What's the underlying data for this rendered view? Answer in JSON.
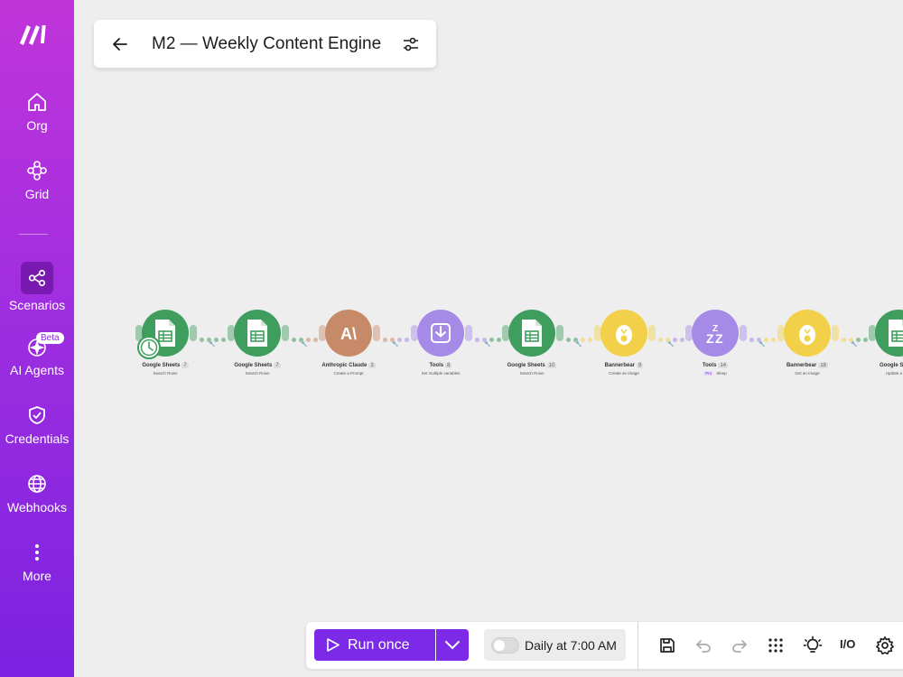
{
  "sidebar": {
    "logo": "make-logo",
    "items": [
      {
        "label": "Org",
        "icon": "home-icon"
      },
      {
        "label": "Grid",
        "icon": "grid-nodes-icon"
      },
      {
        "label": "Scenarios",
        "icon": "share-nodes-icon",
        "active": true
      },
      {
        "label": "AI Agents",
        "icon": "ai-sparkle-icon",
        "badge": "Beta"
      },
      {
        "label": "Credentials",
        "icon": "shield-check-icon"
      },
      {
        "label": "Webhooks",
        "icon": "globe-icon"
      },
      {
        "label": "More",
        "icon": "more-vertical-icon"
      }
    ]
  },
  "header": {
    "title": "M2 — Weekly Content Engine",
    "back_icon": "arrow-left-icon",
    "settings_icon": "sliders-icon"
  },
  "flow": {
    "modules": [
      {
        "name": "Google Sheets",
        "num": "7",
        "action": "Search Rows",
        "icon": "sheets-icon",
        "color": "#3f9e5e"
      },
      {
        "name": "Google Sheets",
        "num": "7",
        "action": "Search Rows",
        "icon": "sheets-icon",
        "color": "#3f9e5e"
      },
      {
        "name": "Anthropic Claude",
        "num": "3",
        "action": "Create a Prompt",
        "icon": "anthropic-icon",
        "color": "#c78a68"
      },
      {
        "name": "Tools",
        "num": "8",
        "action": "Set multiple variables",
        "icon": "tools-download-icon",
        "color": "#a68ae8"
      },
      {
        "name": "Google Sheets",
        "num": "10",
        "action": "Search Rows",
        "icon": "sheets-icon",
        "color": "#3f9e5e"
      },
      {
        "name": "Bannerbear",
        "num": "9",
        "action": "Create an Image",
        "icon": "bannerbear-icon",
        "color": "#f2d04a"
      },
      {
        "name": "Tools",
        "num": "14",
        "action": "Sleep",
        "action_badge": "Pro",
        "icon": "sleep-icon",
        "color": "#a68ae8"
      },
      {
        "name": "Bannerbear",
        "num": "18",
        "action": "Get an Image",
        "icon": "bannerbear-icon",
        "color": "#f2d04a"
      },
      {
        "name": "Google Sheets",
        "num": "",
        "action": "Update a Row",
        "icon": "sheets-icon",
        "color": "#3f9e5e"
      }
    ]
  },
  "toolbar": {
    "run_label": "Run once",
    "schedule_label": "Daily at 7:00 AM",
    "schedule_enabled": false,
    "io_label": "I/O",
    "icons": [
      "save-icon",
      "undo-icon",
      "redo-icon",
      "grid-dots-icon",
      "lightbulb-icon",
      "io-icon",
      "gear-icon"
    ]
  },
  "colors": {
    "accent": "#7d2ae8",
    "sidebar_top": "#c034d9",
    "sidebar_bottom": "#7b22e0",
    "canvas": "#efeeef"
  }
}
